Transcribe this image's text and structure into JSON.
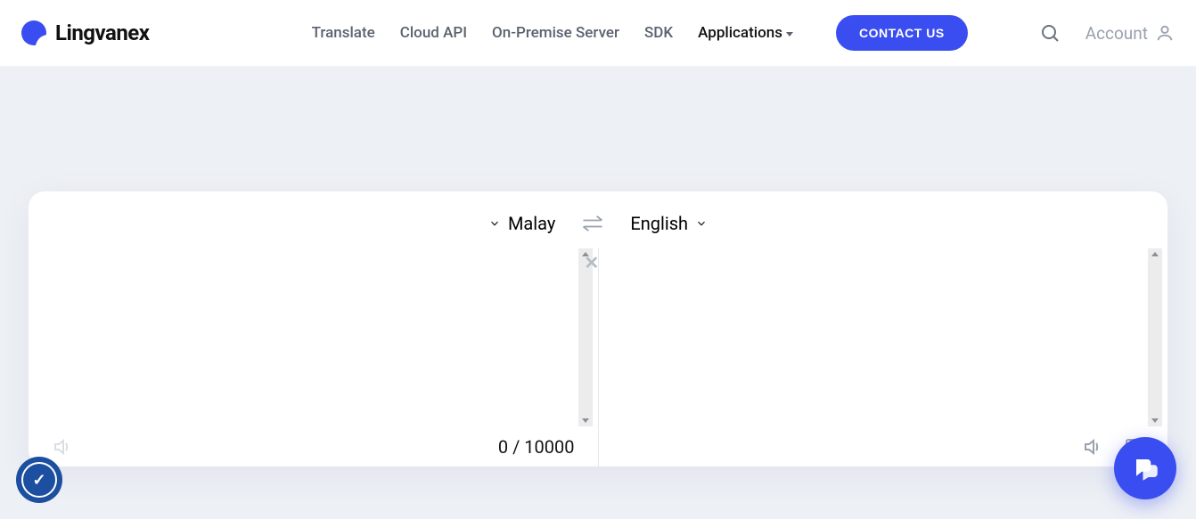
{
  "header": {
    "brand": "Lingvanex",
    "nav": {
      "translate": "Translate",
      "cloud_api": "Cloud API",
      "on_premise": "On-Premise Server",
      "sdk": "SDK",
      "applications": "Applications"
    },
    "contact_label": "CONTACT US",
    "account_label": "Account"
  },
  "translator": {
    "source_lang": "Malay",
    "target_lang": "English",
    "source_text": "",
    "target_text": "",
    "char_count": "0 / 10000"
  }
}
